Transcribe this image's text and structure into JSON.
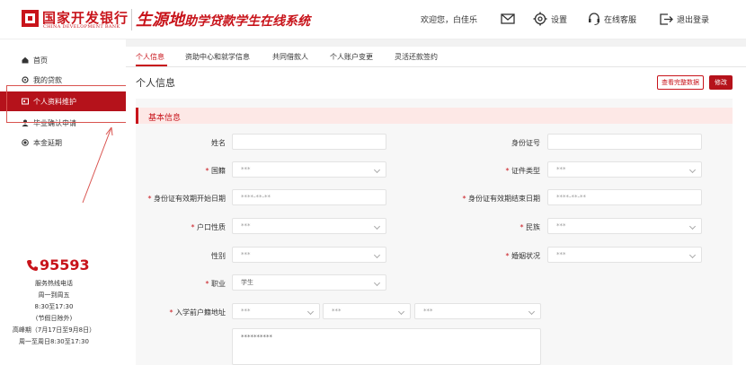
{
  "header": {
    "bank_name": "国家开发银行",
    "bank_name_en": "CHINA DEVELOPMENT BANK",
    "system_title_a": "生源地",
    "system_title_b": "助学贷款学生在线系统",
    "welcome": "欢迎您，白佳乐",
    "settings_label": "设置",
    "service_label": "在线客服",
    "logout_label": "退出登录"
  },
  "sidebar": {
    "items": [
      {
        "label": "首页",
        "icon": "home-icon"
      },
      {
        "label": "我的贷款",
        "icon": "loan-icon"
      },
      {
        "label": "个人资料维护",
        "icon": "profile-card-icon"
      },
      {
        "label": "毕业确认申请",
        "icon": "graduate-icon"
      },
      {
        "label": "本金延期",
        "icon": "extension-icon"
      }
    ],
    "hotline": {
      "number": "95593",
      "title": "服务热线电话",
      "days": "周一到周五",
      "hours": "8:30至17:30",
      "holiday": "(节假日除外)",
      "peak": "高峰期（7月17日至9月8日）",
      "peak_hours": "周一至周日8:30至17:30"
    }
  },
  "tabs": [
    {
      "label": "个人信息"
    },
    {
      "label": "资助中心和就学信息"
    },
    {
      "label": "共同借款人"
    },
    {
      "label": "个人账户变更"
    },
    {
      "label": "灵活还款签约"
    }
  ],
  "page": {
    "title": "个人信息",
    "view_full_button": "查看完整数据",
    "edit_button": "修改",
    "section_title": "基本信息"
  },
  "form": {
    "name_label": "姓名",
    "id_label": "身份证号",
    "nationality_label": "国籍",
    "nationality_value": "***",
    "cert_type_label": "证件类型",
    "cert_type_value": "***",
    "id_start_label": "身份证有效期开始日期",
    "id_start_value": "****-**-**",
    "id_end_label": "身份证有效期结束日期",
    "id_end_value": "****-**-**",
    "hukou_label": "户口性质",
    "hukou_value": "***",
    "ethnicity_label": "民族",
    "ethnicity_value": "***",
    "gender_label": "性别",
    "gender_value": "***",
    "marital_label": "婚姻状况",
    "marital_value": "***",
    "occupation_label": "职业",
    "occupation_value": "学生",
    "address_label": "入学前户籍地址",
    "address_province": "***",
    "address_city": "***",
    "address_district": "***",
    "address_detail": "**********"
  },
  "colors": {
    "brand_red": "#c8141b",
    "active_bg": "#b5121b"
  }
}
